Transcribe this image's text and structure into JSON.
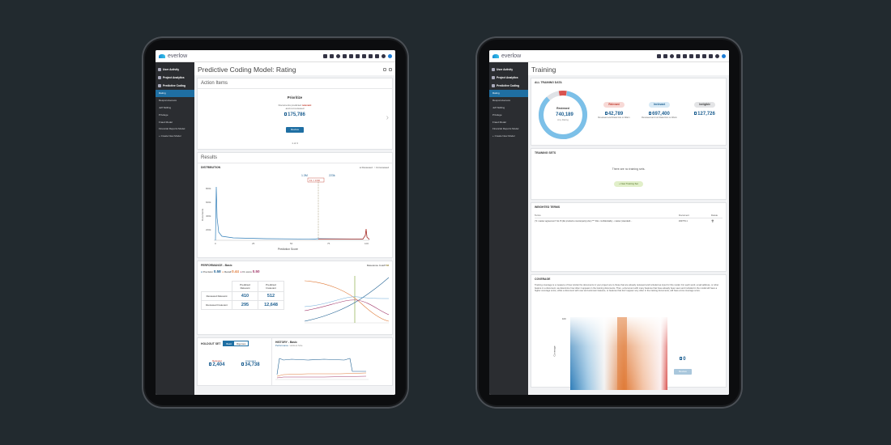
{
  "brand": "everlow",
  "sidebar": {
    "sections": [
      "User Activity",
      "Project Analytics",
      "Predictive Coding"
    ],
    "left_items": [
      "Rating",
      "Responsiveness",
      "Jeff Skilling",
      "Privilege",
      "Fraud Model",
      "Financial Reports Model",
      "+ Create New Model"
    ],
    "right_items": [
      "Rating",
      "Responsiveness",
      "Jeff Skilling",
      "Privilege",
      "Fraud Model",
      "Financial Reports Model",
      "+ Create New Model"
    ]
  },
  "left": {
    "title": "Predictive Coding Model: Rating",
    "action_items": "Action Items",
    "prioritize": {
      "heading": "Prioritize",
      "line1": "Documents predicted",
      "relevant": "relevant",
      "line2": "and not reviewed",
      "count": "175,786",
      "button": "Review",
      "pager": "1 of 3"
    },
    "results": "Results",
    "distribution": {
      "title": "DISTRIBUTION",
      "legend_reviewed": "Reviewed",
      "legend_unreviewed": "Unreviewed",
      "marker_left": "1.3M",
      "marker_right": "223k",
      "marker_f1": "F1 = 0.58",
      "ylabel": "Documents",
      "xlabel": "Prediction Score",
      "yticks": [
        "800k",
        "600k",
        "400k",
        "200k"
      ],
      "xticks": [
        "0",
        "25",
        "50",
        "75",
        "100"
      ]
    },
    "performance": {
      "title": "PERFORMANCE - Basic",
      "relevance_cutoff": "Relevance Cutoff",
      "cutoff_val": "58",
      "precision_label": "Precision",
      "precision": "0.58",
      "recall_label": "Recall",
      "recall": "0.44",
      "f1_label": "F1 score",
      "f1": "0.50",
      "col1": "Predicted Relevant",
      "col2": "Predicted Irrelevant",
      "row1": "Reviewed Relevant",
      "row2": "Reviewed Irrelevant",
      "v11": "410",
      "v12": "512",
      "v21": "295",
      "v22": "12,648"
    },
    "holdout": {
      "title": "HOLDOUT SET",
      "toggle_basic": "Basic",
      "toggle_rigorous": "Rigorous",
      "relevant_label": "Relevant",
      "relevant": "2,404",
      "irrelevant_label": "Irrelevant",
      "irrelevant": "34,738"
    },
    "history": {
      "title": "HISTORY - Basic",
      "tab1": "Performance",
      "tab2": "Holdout Size"
    }
  },
  "right": {
    "title": "Training",
    "all_training": "ALL TRAINING DATA",
    "donut_label": "Reviewed",
    "donut_value": "740,189",
    "donut_sub": "Any Rating",
    "stats": [
      {
        "label": "Relevant",
        "value": "42,789",
        "desc": "Reviewed and Rated Hot or Warm"
      },
      {
        "label": "Irrelevant",
        "value": "697,400",
        "desc": "Reviewed and not Rated Hot or Warm"
      },
      {
        "label": "Ineligible",
        "value": "127,726",
        "desc": ""
      }
    ],
    "training_sets": "TRAINING SETS",
    "no_sets": "There are no training sets.",
    "new_set": "+ New Training Set",
    "weighted_terms": "WEIGHTED TERMS",
    "wt_cols": [
      "Terms",
      "Document",
      "Delete"
    ],
    "wt_row": {
      "term": "(\"it: master agreement\" list /5 (list products counterparty).doc) *** File: confidentiality - master (standard...",
      "doc": "#40779.1"
    },
    "coverage": "COVERAGE",
    "coverage_text": "Training coverage is a measure of how similar the documents in your project are to those that are already reviewed and included as input for this model. For each word, email address, or other feature in a document, we determine how often it appears in the training documents. Then, a document with many features that have already been seen and included in the model will have a higher coverage score, while a document with new and unknown features, or features that don't appear very often in the training documents, will have a low coverage score.",
    "coverage_ymax": "100",
    "coverage_ylabel": "Coverage",
    "coverage_count": "0",
    "coverage_button": "Review"
  },
  "colors": {
    "accent": "#1f6fa3",
    "relevant": "#c0392b",
    "irrelevant": "#2f7db8",
    "orange": "#e07b39"
  }
}
